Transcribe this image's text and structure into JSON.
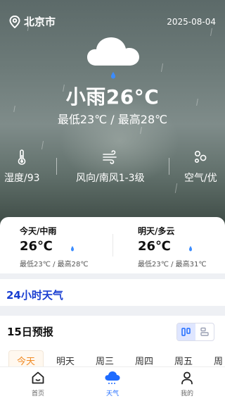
{
  "header": {
    "city": "北京市",
    "date": "2025-08-04"
  },
  "current": {
    "condition_temp": "小雨26°C",
    "range": "最低23℃ / 最高28℃"
  },
  "stats": [
    {
      "icon": "thermometer-icon",
      "label": "湿度/93"
    },
    {
      "icon": "wind-icon",
      "label": "风向/南风1-3级"
    },
    {
      "icon": "air-quality-icon",
      "label": "空气/优"
    }
  ],
  "forecast_cards": [
    {
      "title": "今天/中雨",
      "temp": "26℃",
      "range": "最低23℃ / 最高28℃"
    },
    {
      "title": "明天/多云",
      "temp": "26℃",
      "range": "最低23℃ / 最高31℃"
    }
  ],
  "sections": {
    "hourly_title": "24小时天气",
    "daily_title": "15日预报"
  },
  "days": [
    "今天",
    "明天",
    "周三",
    "周四",
    "周五",
    "周"
  ],
  "nav": [
    {
      "label": "首页",
      "icon": "home-icon"
    },
    {
      "label": "天气",
      "icon": "weather-icon"
    },
    {
      "label": "我的",
      "icon": "profile-icon"
    }
  ],
  "colors": {
    "accent": "#1a3fd1",
    "active_nav": "#1e6bff",
    "active_day": "#f08a24"
  }
}
